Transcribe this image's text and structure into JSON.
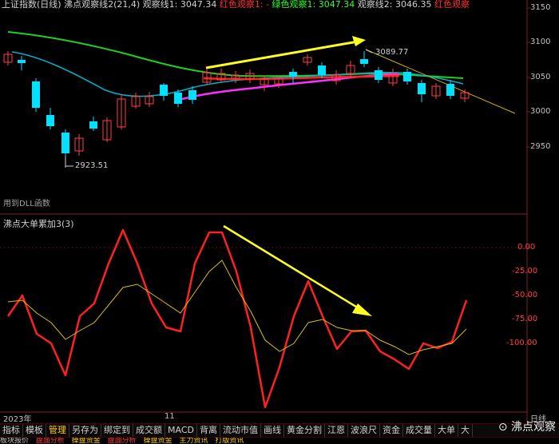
{
  "main_panel": {
    "title_parts": [
      {
        "text": "上证指数(日线)",
        "color": "#d0d0d0"
      },
      {
        "text": "沸点观察线2(21,4)",
        "color": "#d0d0d0"
      },
      {
        "text": "观察线1: 3047.34",
        "color": "#d0d0d0"
      },
      {
        "text": "红色观察1: -",
        "color": "#ff3030"
      },
      {
        "text": "绿色观察1: 3047.34",
        "color": "#30ff30"
      },
      {
        "text": "观察线2: 3046.35",
        "color": "#d0d0d0"
      },
      {
        "text": "红色观察",
        "color": "#ff3030"
      }
    ],
    "y_ticks": [
      "3150",
      "3100",
      "3050",
      "3000",
      "2950"
    ],
    "annotation_high": "3089.77",
    "annotation_low": "2923.51",
    "dll_note": "用到DLL函数"
  },
  "sub_panel": {
    "title": "沸点大单累加3(3)",
    "y_ticks": [
      "0.00",
      "-25.00",
      "-50.00",
      "-75.00",
      "-100.00"
    ]
  },
  "x_axis": {
    "left_label": "2023年",
    "mid_label": "11",
    "right_label": "日线"
  },
  "toolbar": {
    "items": [
      "指标",
      "模板",
      "管理",
      "另存为",
      "绑定到",
      "成交额",
      "MACD",
      "背离",
      "流动市值",
      "画线",
      "黄金分割",
      "江恩",
      "波浪尺",
      "资金",
      "成交量",
      "大单",
      "大"
    ],
    "active_index": 2
  },
  "bottom_bar": {
    "items": [
      "板块报价",
      "盘面分析",
      "操盘资金",
      "盘面分析",
      "操盘资金",
      "主力资讯",
      "打版资讯"
    ]
  },
  "watermark": "沸点观察",
  "colors": {
    "up": "#ff4040",
    "down": "#00e0ff",
    "line_green": "#20d020",
    "line_cyan": "#00b0c8",
    "line_magenta": "#ff30ff",
    "line_red": "#ff2020",
    "arrow_yellow": "#ffff20",
    "trend_yellow": "#d0b000"
  }
}
